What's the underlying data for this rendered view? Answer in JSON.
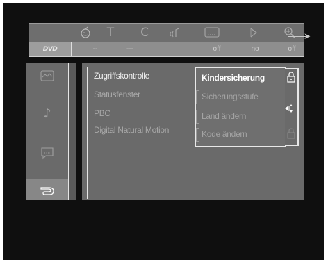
{
  "toolbar": {
    "icons": [
      "face-icon",
      "text-icon",
      "clock-icon",
      "voice-icon",
      "subtitle-icon",
      "angle-icon",
      "zoom-icon"
    ],
    "glyph_t": "T",
    "glyph_c": "C"
  },
  "status": {
    "disc_logo": "DVD",
    "values": [
      "--",
      "---",
      "off",
      "no",
      "off"
    ]
  },
  "sidebar": {
    "items": [
      "picture-icon",
      "music-note-icon",
      "speech-bubble-icon",
      "hand-pointer-icon"
    ],
    "selected": "hand-pointer-icon"
  },
  "menu": {
    "items": [
      "Zugriffskontrolle",
      "Statusfenster",
      "PBC",
      "Digital Natural Motion"
    ],
    "active": "Zugriffskontrolle"
  },
  "submenu": {
    "items": [
      "Kindersicherung",
      "Sicherungsstufe",
      "Land ändern",
      "Kode ändern"
    ],
    "selected": "Kindersicherung"
  },
  "colors": {
    "screen_bg": "#0f0f0f",
    "panel": "#6a6a6a",
    "highlight": "#ffffff"
  }
}
